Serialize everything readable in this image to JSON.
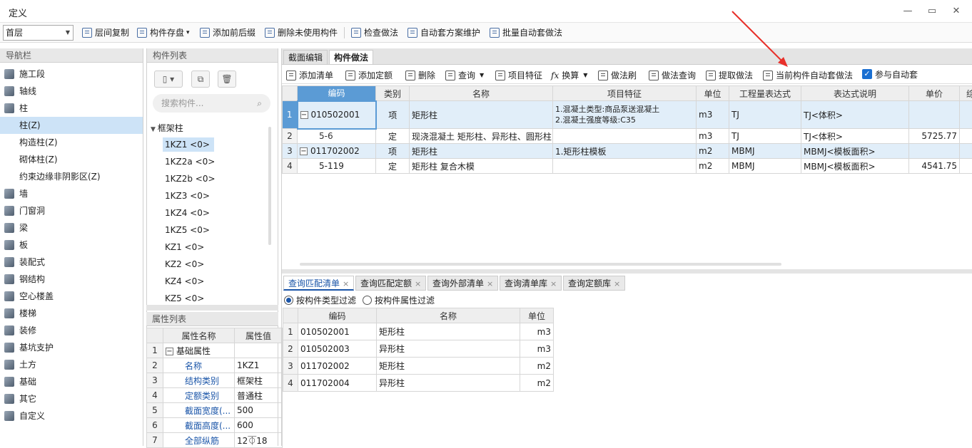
{
  "window": {
    "title": "定义",
    "controls": [
      "—",
      "▭",
      "✕"
    ]
  },
  "toolbar1": {
    "floor": "首层",
    "items": [
      "层间复制",
      "构件存盘",
      "添加前后缀",
      "删除未使用构件",
      "检查做法",
      "自动套方案维护",
      "批量自动套做法"
    ],
    "dropdown_marks": [
      "▾",
      "▾"
    ]
  },
  "nav": {
    "title": "导航栏",
    "items": [
      "施工段",
      "轴线",
      "柱",
      "柱(Z)",
      "构造柱(Z)",
      "砌体柱(Z)",
      "约束边缘非阴影区(Z)",
      "墙",
      "门窗洞",
      "梁",
      "板",
      "装配式",
      "钢结构",
      "空心楼盖",
      "楼梯",
      "装修",
      "基坑支护",
      "土方",
      "基础",
      "其它",
      "自定义"
    ]
  },
  "components": {
    "title": "构件列表",
    "search_placeholder": "搜索构件...",
    "group": "框架柱",
    "items": [
      "1KZ1 <0>",
      "1KZ2a <0>",
      "1KZ2b <0>",
      "1KZ3 <0>",
      "1KZ4 <0>",
      "1KZ5 <0>",
      "KZ1 <0>",
      "KZ2 <0>",
      "KZ4 <0>",
      "KZ5 <0>"
    ]
  },
  "props": {
    "title": "属性列表",
    "headers": [
      "属性名称",
      "属性值"
    ],
    "rows": [
      {
        "n": "1",
        "name": "基础属性",
        "value": ""
      },
      {
        "n": "2",
        "name": "名称",
        "value": "1KZ1"
      },
      {
        "n": "3",
        "name": "结构类别",
        "value": "框架柱"
      },
      {
        "n": "4",
        "name": "定额类别",
        "value": "普通柱"
      },
      {
        "n": "5",
        "name": "截面宽度(...",
        "value": "500"
      },
      {
        "n": "6",
        "name": "截面高度(...",
        "value": "600"
      },
      {
        "n": "7",
        "name": "全部纵筋",
        "value": "12⏁18"
      }
    ]
  },
  "tabs": [
    "截面编辑",
    "构件做法"
  ],
  "toolbar2": {
    "items": [
      "添加清单",
      "添加定额",
      "删除",
      "查询",
      "项目特征",
      "换算",
      "做法刷",
      "做法查询",
      "提取做法",
      "当前构件自动套做法",
      "参与自动套"
    ]
  },
  "main_table": {
    "headers": [
      "编码",
      "类别",
      "名称",
      "项目特征",
      "单位",
      "工程量表达式",
      "表达式说明",
      "单价",
      "综"
    ],
    "rows": [
      {
        "n": "1",
        "code": "010502001",
        "type": "项",
        "name": "矩形柱",
        "feature": "1.混凝土类型:商品泵送混凝土",
        "feature2": "2.混凝土强度等级:C35",
        "unit": "m3",
        "expr": "TJ",
        "desc": "TJ<体积>",
        "price": ""
      },
      {
        "n": "2",
        "code": "5-6",
        "type": "定",
        "name": "现浇混凝土 矩形柱、异形柱、圆形柱",
        "feature": "",
        "unit": "m3",
        "expr": "TJ",
        "desc": "TJ<体积>",
        "price": "5725.77"
      },
      {
        "n": "3",
        "code": "011702002",
        "type": "项",
        "name": "矩形柱",
        "feature": "1.矩形柱模板",
        "unit": "m2",
        "expr": "MBMJ",
        "desc": "MBMJ<模板面积>",
        "price": ""
      },
      {
        "n": "4",
        "code": "5-119",
        "type": "定",
        "name": "矩形柱 复合木模",
        "feature": "",
        "unit": "m2",
        "expr": "MBMJ",
        "desc": "MBMJ<模板面积>",
        "price": "4541.75"
      }
    ]
  },
  "bottom_tabs": [
    "查询匹配清单",
    "查询匹配定额",
    "查询外部清单",
    "查询清单库",
    "查询定额库"
  ],
  "filters": [
    "按构件类型过滤",
    "按构件属性过滤"
  ],
  "query_table": {
    "headers": [
      "编码",
      "名称",
      "单位"
    ],
    "rows": [
      {
        "n": "1",
        "code": "010502001",
        "name": "矩形柱",
        "unit": "m3"
      },
      {
        "n": "2",
        "code": "010502003",
        "name": "异形柱",
        "unit": "m3"
      },
      {
        "n": "3",
        "code": "011702002",
        "name": "矩形柱",
        "unit": "m2"
      },
      {
        "n": "4",
        "code": "011702004",
        "name": "异形柱",
        "unit": "m2"
      }
    ]
  },
  "colors": {
    "selection": "#cde3f7",
    "accent": "#1a55a8",
    "arrow": "#e8302a"
  }
}
